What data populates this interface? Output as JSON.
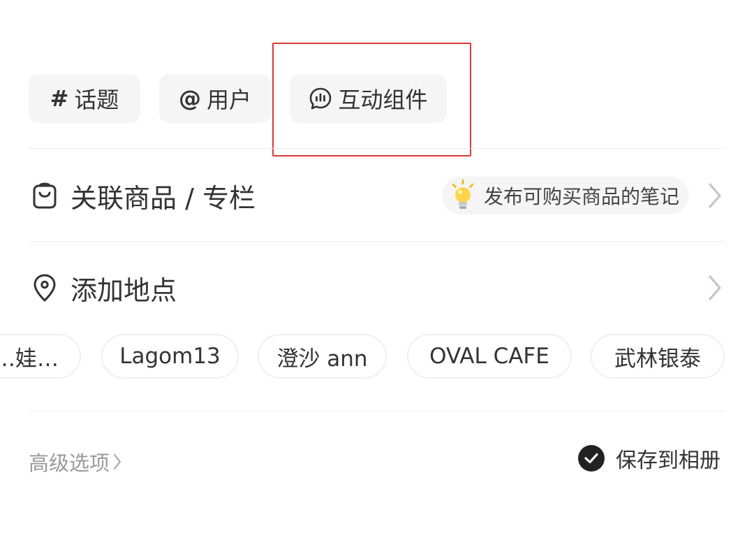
{
  "toolbar": {
    "topic_icon": "#",
    "topic_label": "话题",
    "user_icon": "@",
    "user_label": "用户",
    "interactive_label": "互动组件"
  },
  "highlight_color": "#d93a3a",
  "products_row": {
    "label": "关联商品 / 专栏",
    "hint": "发布可购买商品的笔记"
  },
  "location_row": {
    "label": "添加地点",
    "suggestions": [
      "…娃…",
      "Lagom13",
      "澄沙 ann",
      "OVAL CAFE",
      "武林银泰"
    ]
  },
  "footer": {
    "advanced_label": "高级选项",
    "save_label": "保存到相册"
  }
}
